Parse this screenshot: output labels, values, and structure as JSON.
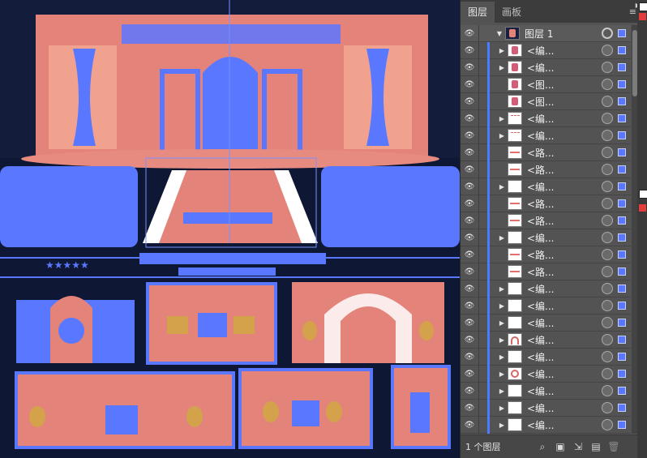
{
  "panel": {
    "tabs": [
      {
        "label": "图层",
        "active": true
      },
      {
        "label": "画板",
        "active": false
      }
    ],
    "top_layer": {
      "name": "图层 1",
      "expanded": true
    },
    "layers": [
      {
        "name": "<编...",
        "expandable": true,
        "thumb": "pic"
      },
      {
        "name": "<编...",
        "expandable": true,
        "thumb": "pic"
      },
      {
        "name": "<图...",
        "expandable": false,
        "thumb": "pic"
      },
      {
        "name": "<图...",
        "expandable": false,
        "thumb": "pic"
      },
      {
        "name": "<编...",
        "expandable": true,
        "thumb": "tiny"
      },
      {
        "name": "<编...",
        "expandable": true,
        "thumb": "tiny"
      },
      {
        "name": "<路...",
        "expandable": false,
        "thumb": "mark"
      },
      {
        "name": "<路...",
        "expandable": false,
        "thumb": "mark"
      },
      {
        "name": "<编...",
        "expandable": true,
        "thumb": "blank"
      },
      {
        "name": "<路...",
        "expandable": false,
        "thumb": "mark"
      },
      {
        "name": "<路...",
        "expandable": false,
        "thumb": "mark"
      },
      {
        "name": "<编...",
        "expandable": true,
        "thumb": "blank"
      },
      {
        "name": "<路...",
        "expandable": false,
        "thumb": "mark"
      },
      {
        "name": "<路...",
        "expandable": false,
        "thumb": "mark"
      },
      {
        "name": "<编...",
        "expandable": true,
        "thumb": "blank"
      },
      {
        "name": "<编...",
        "expandable": true,
        "thumb": "blank"
      },
      {
        "name": "<编...",
        "expandable": true,
        "thumb": "blank"
      },
      {
        "name": "<编...",
        "expandable": true,
        "thumb": "arch"
      },
      {
        "name": "<编...",
        "expandable": true,
        "thumb": "blank"
      },
      {
        "name": "<编...",
        "expandable": true,
        "thumb": "ring"
      },
      {
        "name": "<编...",
        "expandable": true,
        "thumb": "blank"
      },
      {
        "name": "<编...",
        "expandable": true,
        "thumb": "blank"
      },
      {
        "name": "<编...",
        "expandable": true,
        "thumb": "blank"
      }
    ],
    "footer": {
      "count_label": "1 个图层"
    }
  },
  "canvas": {
    "stars_count": "★★★★★",
    "accent_selection": "#5a78ff",
    "artwork_pink": "#e4837a",
    "background": "#0e1733"
  }
}
